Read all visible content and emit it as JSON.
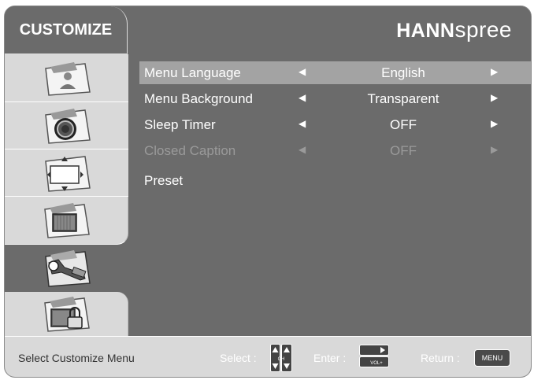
{
  "header": {
    "title": "CUSTOMIZE",
    "brand_bold": "HANN",
    "brand_light": "spree"
  },
  "sidebar": {
    "items": [
      {
        "name": "picture-icon",
        "active": false
      },
      {
        "name": "sound-icon",
        "active": false
      },
      {
        "name": "screen-icon",
        "active": false
      },
      {
        "name": "pc-icon",
        "active": false
      },
      {
        "name": "customize-icon",
        "active": true
      },
      {
        "name": "parental-lock-icon",
        "active": false
      }
    ]
  },
  "menu": {
    "rows": [
      {
        "label": "Menu Language",
        "value": "English",
        "left_arrow": "◀",
        "right_arrow": "▶",
        "selected": true,
        "disabled": false
      },
      {
        "label": "Menu Background",
        "value": "Transparent",
        "left_arrow": "◀",
        "right_arrow": "▶",
        "selected": false,
        "disabled": false
      },
      {
        "label": "Sleep Timer",
        "value": "OFF",
        "left_arrow": "◀",
        "right_arrow": "▶",
        "selected": false,
        "disabled": false
      },
      {
        "label": "Closed Caption",
        "value": "OFF",
        "left_arrow": "◀",
        "right_arrow": "▶",
        "selected": false,
        "disabled": true
      },
      {
        "label": "Preset",
        "value": "",
        "left_arrow": "",
        "right_arrow": "",
        "selected": false,
        "disabled": false
      }
    ]
  },
  "footer": {
    "hint": "Select Customize Menu",
    "select_label": "Select :",
    "ch_key": "CH",
    "enter_label": "Enter :",
    "vol_key": "VOL+",
    "return_label": "Return :",
    "menu_key": "MENU"
  },
  "colors": {
    "panel": "#6b6b6b",
    "sidebar": "#d9d9d9",
    "selected_row": "#a3a3a3",
    "disabled_text": "#9a9a9a"
  }
}
